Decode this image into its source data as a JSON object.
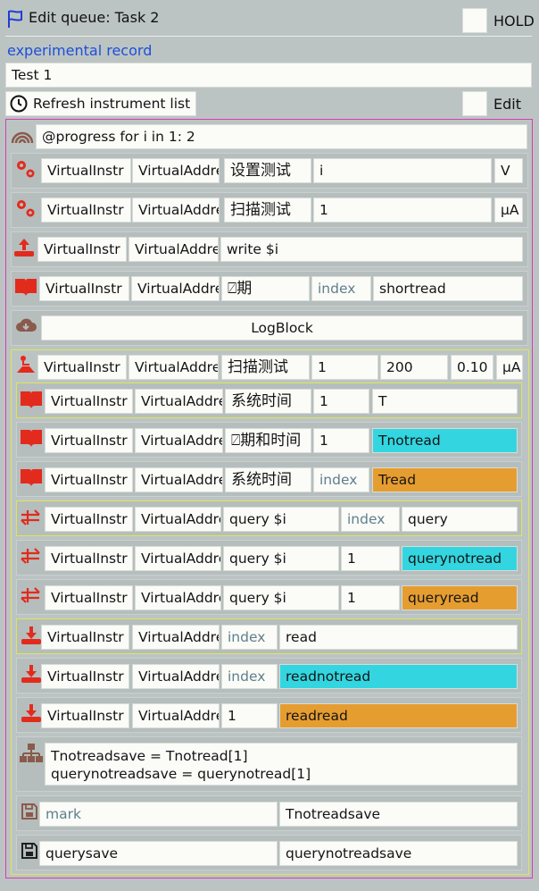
{
  "header": {
    "title": "Edit queue: Task 2",
    "hold_label": "HOLD",
    "hold_checked": false
  },
  "record": {
    "label": "experimental record",
    "name_value": "Test 1"
  },
  "toolbar": {
    "refresh_label": "Refresh instrument list",
    "edit_label": "Edit",
    "edit_checked": false
  },
  "colors": {
    "cyan": "#33d6e0",
    "orange": "#e69d30",
    "outer_border": "#d83cb4",
    "inner_border": "#dfe45a",
    "icon_red": "#e22b1d"
  },
  "rows": [
    {
      "type": "progress",
      "icon": "progress-rainbow-icon",
      "text": "@progress for i in 1: 2"
    },
    {
      "type": "set",
      "icon": "gears-icon",
      "inst": "VirtualInstr",
      "addr": "VirtualAddre",
      "name": "设置测试",
      "value": "i",
      "unit": "V"
    },
    {
      "type": "set",
      "icon": "gears-icon",
      "inst": "VirtualInstr",
      "addr": "VirtualAddre",
      "name": "扫描测试",
      "value": "1",
      "unit": "μA"
    },
    {
      "type": "write",
      "icon": "upload-icon",
      "inst": "VirtualInstr",
      "addr": "VirtualAddre",
      "cmd": "write $i"
    },
    {
      "type": "read",
      "icon": "book-icon",
      "inst": "VirtualInstr",
      "addr": "VirtualAddre",
      "name": "⍁期",
      "index": "index",
      "target": "shortread"
    },
    {
      "type": "log",
      "icon": "cloud-download-icon",
      "label": "LogBlock"
    },
    {
      "type": "sweep",
      "icon": "sweep-icon",
      "inst": "VirtualInstr",
      "addr": "VirtualAddre",
      "name": "扫描测试",
      "start": "1",
      "stop": "200",
      "step": "0.10",
      "unit": "μA"
    },
    {
      "type": "read",
      "icon": "book-icon",
      "inst": "VirtualInstr",
      "addr": "VirtualAddre",
      "name": "系统时间",
      "index": "1",
      "target": "T"
    },
    {
      "type": "read",
      "icon": "book-icon",
      "inst": "VirtualInstr",
      "addr": "VirtualAddre",
      "name": "⍁期和时间",
      "index": "1",
      "target": "Tnotread"
    },
    {
      "type": "read",
      "icon": "book-icon",
      "inst": "VirtualInstr",
      "addr": "VirtualAddre",
      "name": "系统时间",
      "index": "index",
      "target": "Tread"
    },
    {
      "type": "query",
      "icon": "arrows-swap-icon",
      "inst": "VirtualInstr",
      "addr": "VirtualAddre",
      "cmd": "query $i",
      "index": "index",
      "target": "query"
    },
    {
      "type": "query",
      "icon": "arrows-swap-icon",
      "inst": "VirtualInstr",
      "addr": "VirtualAddre",
      "cmd": "query $i",
      "index": "1",
      "target": "querynotread"
    },
    {
      "type": "query",
      "icon": "arrows-swap-icon",
      "inst": "VirtualInstr",
      "addr": "VirtualAddre",
      "cmd": "query $i",
      "index": "1",
      "target": "queryread"
    },
    {
      "type": "readonly",
      "icon": "download-icon",
      "inst": "VirtualInstr",
      "addr": "VirtualAddre",
      "index": "index",
      "target": "read"
    },
    {
      "type": "readonly",
      "icon": "download-icon",
      "inst": "VirtualInstr",
      "addr": "VirtualAddre",
      "index": "index",
      "target": "readnotread"
    },
    {
      "type": "readonly",
      "icon": "download-icon",
      "inst": "VirtualInstr",
      "addr": "VirtualAddre",
      "index": "1",
      "target": "readread"
    },
    {
      "type": "compute",
      "icon": "hierarchy-icon",
      "line1": "Tnotreadsave = Tnotread[1]",
      "line2": "querynotreadsave = querynotread[1]"
    },
    {
      "type": "save",
      "icon": "floppy-icon",
      "name": "mark",
      "value": "Tnotreadsave"
    },
    {
      "type": "save",
      "icon": "floppy-icon",
      "name": "querysave",
      "value": "querynotreadsave"
    }
  ]
}
